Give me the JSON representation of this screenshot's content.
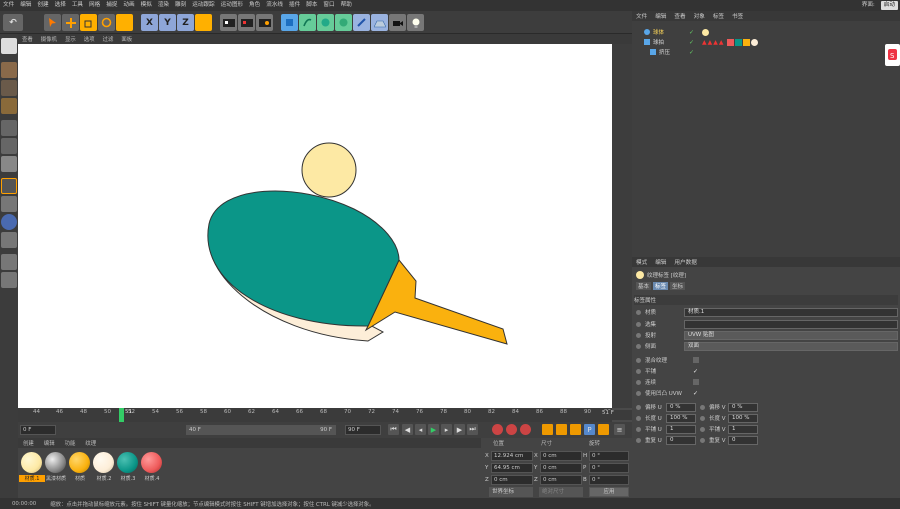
{
  "menu": {
    "items": [
      "文件",
      "编辑",
      "创建",
      "选择",
      "工具",
      "网格",
      "捕捉",
      "动画",
      "模拟",
      "渲染",
      "雕刻",
      "运动跟踪",
      "运动图形",
      "角色",
      "流水线",
      "插件",
      "脚本",
      "窗口",
      "帮助"
    ],
    "interface_label": "界面:",
    "interface_value": "启动"
  },
  "toolbar": {
    "axis_x": "X",
    "axis_y": "Y",
    "axis_z": "Z"
  },
  "viewport": {
    "menu": [
      "查看",
      "摄像机",
      "显示",
      "选项",
      "过滤",
      "面板"
    ]
  },
  "colors": {
    "teal": "#0b9688",
    "orange": "#fab10e",
    "cream": "#fdeed8",
    "ball": "#fde9a4",
    "red": "#ee5a5a"
  },
  "timeline": {
    "ticks": [
      "44",
      "46",
      "48",
      "50",
      "52",
      "54",
      "56",
      "58",
      "60",
      "62",
      "64",
      "66",
      "68",
      "70",
      "72",
      "74",
      "76",
      "78",
      "80",
      "82",
      "84",
      "86",
      "88",
      "90",
      "92"
    ],
    "current_frame": "51",
    "end_frame_label": "51 F",
    "start_field": "0 F",
    "range_start": "40 F",
    "range_end": "90 F",
    "max_field": "90 F"
  },
  "materials": {
    "tabs": [
      "创建",
      "编辑",
      "功能",
      "纹理"
    ],
    "items": [
      {
        "label": "材质.1",
        "color": "#fde9a4"
      },
      {
        "label": "黑漆材质",
        "color": "#6d6d6d"
      },
      {
        "label": "材质",
        "color": "#fab10e"
      },
      {
        "label": "材质.2",
        "color": "#fdeed8"
      },
      {
        "label": "材质.3",
        "color": "#0b9688"
      },
      {
        "label": "材质.4",
        "color": "#ee5a5a"
      }
    ]
  },
  "coordinates": {
    "headers": [
      "位置",
      "尺寸",
      "旋转"
    ],
    "x_pos": "12.924 cm",
    "y_pos": "64.95 cm",
    "z_pos": "0 cm",
    "x_size": "0 cm",
    "y_size": "0 cm",
    "z_size": "0 cm",
    "h_rot": "0 °",
    "p_rot": "0 °",
    "b_rot": "0 °",
    "x_label": "X",
    "y_label": "Y",
    "z_label": "Z",
    "h_label": "H",
    "p_label": "P",
    "b_label": "B",
    "mode": "世界坐标",
    "scale_mode": "绝对尺寸",
    "apply": "应用"
  },
  "objects": {
    "menu": [
      "文件",
      "编辑",
      "查看",
      "对象",
      "标签",
      "书签"
    ],
    "rows": [
      {
        "name": "球体",
        "color": "#ffd85a"
      },
      {
        "name": "球拍",
        "color": "#ddd"
      },
      {
        "name": "挤压",
        "color": "#ddd"
      }
    ]
  },
  "attributes": {
    "menu": [
      "模式",
      "编辑",
      "用户数据"
    ],
    "title": "纹理标签 [纹理]",
    "tabs": [
      "基本",
      "标签",
      "坐标"
    ],
    "section": "标签属性",
    "material_label": "材质",
    "material_value": "材质.1",
    "selection_label": "选集",
    "projection_label": "投射",
    "projection_value": "UVW 贴图",
    "side_label": "侧面",
    "side_value": "双面",
    "mix_label": "混合纹理",
    "tile_label": "平铺",
    "seamless_label": "连续",
    "uvw_label": "使用凹凸 UVW",
    "offset_u_label": "偏移 U",
    "offset_u": "0 %",
    "offset_v_label": "偏移 V",
    "offset_v": "0 %",
    "length_u_label": "长度 U",
    "length_u": "100 %",
    "length_v_label": "长度 V",
    "length_v": "100 %",
    "tiles_u_label": "平铺 U",
    "tiles_u": "1",
    "tiles_v_label": "平铺 V",
    "tiles_v": "1",
    "repeat_u_label": "重复 U",
    "repeat_u": "0",
    "repeat_v_label": "重复 V",
    "repeat_v": "0"
  },
  "status": {
    "time": "00:00:00",
    "message": "缩放：点击并拖动鼠标缩放元素。按住 SHIFT 键量化缩放；节点编辑模式时按住 SHIFT 键增加选择对象；按住 CTRL 键减少选择对象。"
  }
}
